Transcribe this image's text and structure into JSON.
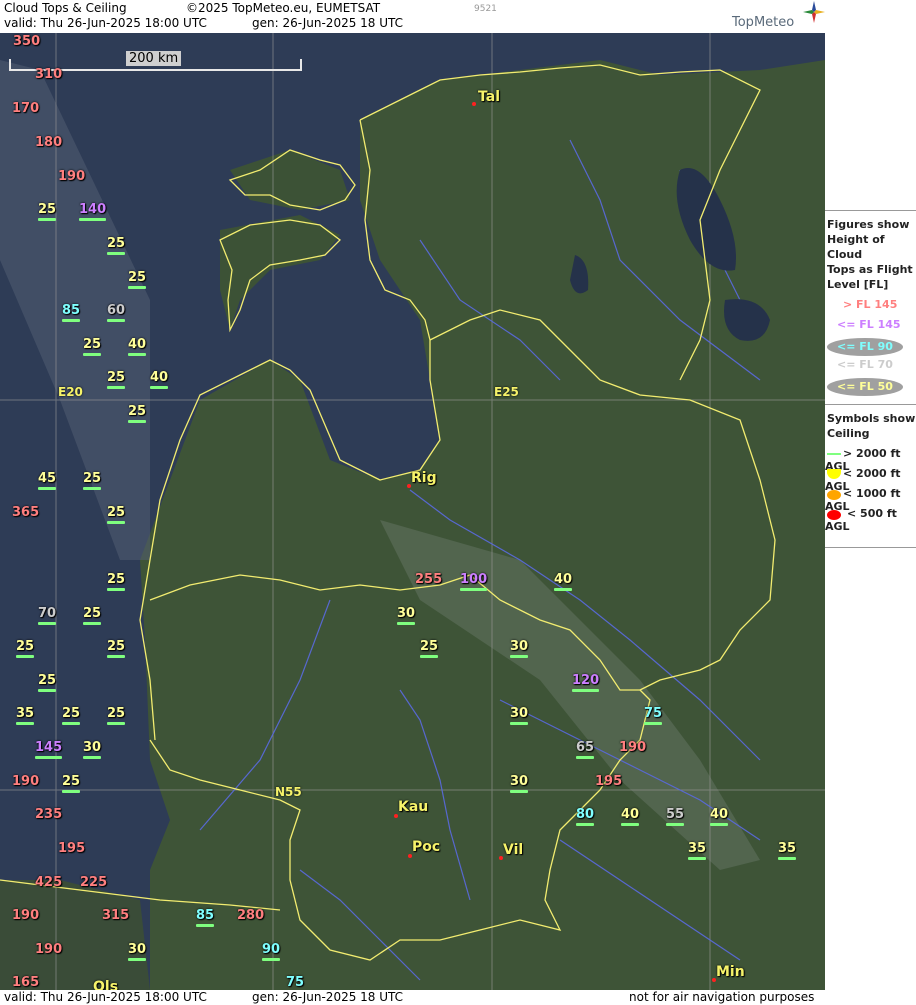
{
  "header": {
    "product": "Cloud Tops & Ceiling",
    "copyright": "©2025 TopMeteo.eu, EUMETSAT",
    "code": "9521",
    "valid": "valid:  Thu  26-Jun-2025  18:00 UTC",
    "gen": "gen: 26-Jun-2025 18 UTC",
    "brand": "TopMeteo"
  },
  "footer": {
    "valid": "valid:  Thu  26-Jun-2025  18:00 UTC",
    "gen": "gen: 26-Jun-2025 18 UTC",
    "disclaimer": "not for air navigation purposes"
  },
  "scale": {
    "label": "200 km"
  },
  "grid": {
    "e20": "E20",
    "e25": "E25",
    "n55": "N55"
  },
  "cities": {
    "tal": "Tal",
    "rig": "Rig",
    "kau": "Kau",
    "poc": "Poc",
    "vil": "Vil",
    "min": "Min",
    "ols": "Ols"
  },
  "colors": {
    "high": "#ff7f7f",
    "mid": "#cc7fff",
    "low90": "#7fffff",
    "low70": "#cccccc",
    "low50": "#ffff99",
    "ceil_gt2000": "#7fff7f",
    "ceil_lt2000": "#ffff00",
    "ceil_lt1000": "#ffa500",
    "ceil_lt500": "#ff0000"
  },
  "legend": {
    "title1": "Figures show",
    "title2": "Height of Cloud",
    "title3": "Tops as Flight",
    "title4": "Level  [FL]",
    "gt145": "> FL 145",
    "le145": "<= FL 145",
    "le90": "<= FL 90",
    "le70": "<= FL 70",
    "le50": "<= FL 50",
    "sym1": "Symbols show",
    "sym2": "Ceiling",
    "c1": "> 2000 ft AGL",
    "c2": "< 2000 ft AGL",
    "c3": "< 1000 ft AGL",
    "c4": "< 500 ft AGL"
  },
  "labels": [
    {
      "v": "350",
      "c": "high"
    },
    {
      "v": "310",
      "c": "high"
    },
    {
      "v": "170",
      "c": "high"
    },
    {
      "v": "180",
      "c": "high"
    },
    {
      "v": "190",
      "c": "high"
    },
    {
      "v": "25",
      "c": "low50"
    },
    {
      "v": "140",
      "c": "mid"
    },
    {
      "v": "25",
      "c": "low50"
    },
    {
      "v": "25",
      "c": "low50"
    },
    {
      "v": "85",
      "c": "low90"
    },
    {
      "v": "60",
      "c": "low70"
    },
    {
      "v": "25",
      "c": "low50"
    },
    {
      "v": "40",
      "c": "low50"
    },
    {
      "v": "25",
      "c": "low50"
    },
    {
      "v": "40",
      "c": "low50"
    },
    {
      "v": "25",
      "c": "low50"
    },
    {
      "v": "45",
      "c": "low50"
    },
    {
      "v": "25",
      "c": "low50"
    },
    {
      "v": "365",
      "c": "high"
    },
    {
      "v": "25",
      "c": "low50"
    },
    {
      "v": "25",
      "c": "low50"
    },
    {
      "v": "70",
      "c": "low70"
    },
    {
      "v": "25",
      "c": "low50"
    },
    {
      "v": "25",
      "c": "low50"
    },
    {
      "v": "25",
      "c": "low50"
    },
    {
      "v": "25",
      "c": "low50"
    },
    {
      "v": "35",
      "c": "low50"
    },
    {
      "v": "25",
      "c": "low50"
    },
    {
      "v": "25",
      "c": "low50"
    },
    {
      "v": "145",
      "c": "mid"
    },
    {
      "v": "30",
      "c": "low50"
    },
    {
      "v": "190",
      "c": "high"
    },
    {
      "v": "25",
      "c": "low50"
    },
    {
      "v": "235",
      "c": "high"
    },
    {
      "v": "195",
      "c": "high"
    },
    {
      "v": "425",
      "c": "high"
    },
    {
      "v": "225",
      "c": "high"
    },
    {
      "v": "190",
      "c": "high"
    },
    {
      "v": "315",
      "c": "high"
    },
    {
      "v": "85",
      "c": "low90"
    },
    {
      "v": "280",
      "c": "high"
    },
    {
      "v": "190",
      "c": "high"
    },
    {
      "v": "30",
      "c": "low50"
    },
    {
      "v": "90",
      "c": "low90"
    },
    {
      "v": "165",
      "c": "high"
    },
    {
      "v": "75",
      "c": "low90"
    },
    {
      "v": "255",
      "c": "high"
    },
    {
      "v": "100",
      "c": "mid"
    },
    {
      "v": "40",
      "c": "low50"
    },
    {
      "v": "30",
      "c": "low50"
    },
    {
      "v": "25",
      "c": "low50"
    },
    {
      "v": "30",
      "c": "low50"
    },
    {
      "v": "120",
      "c": "mid"
    },
    {
      "v": "30",
      "c": "low50"
    },
    {
      "v": "75",
      "c": "low90"
    },
    {
      "v": "65",
      "c": "low70"
    },
    {
      "v": "190",
      "c": "high"
    },
    {
      "v": "30",
      "c": "low50"
    },
    {
      "v": "195",
      "c": "high"
    },
    {
      "v": "80",
      "c": "low90"
    },
    {
      "v": "40",
      "c": "low50"
    },
    {
      "v": "55",
      "c": "low70"
    },
    {
      "v": "40",
      "c": "low50"
    },
    {
      "v": "35",
      "c": "low50"
    },
    {
      "v": "35",
      "c": "low50"
    }
  ]
}
